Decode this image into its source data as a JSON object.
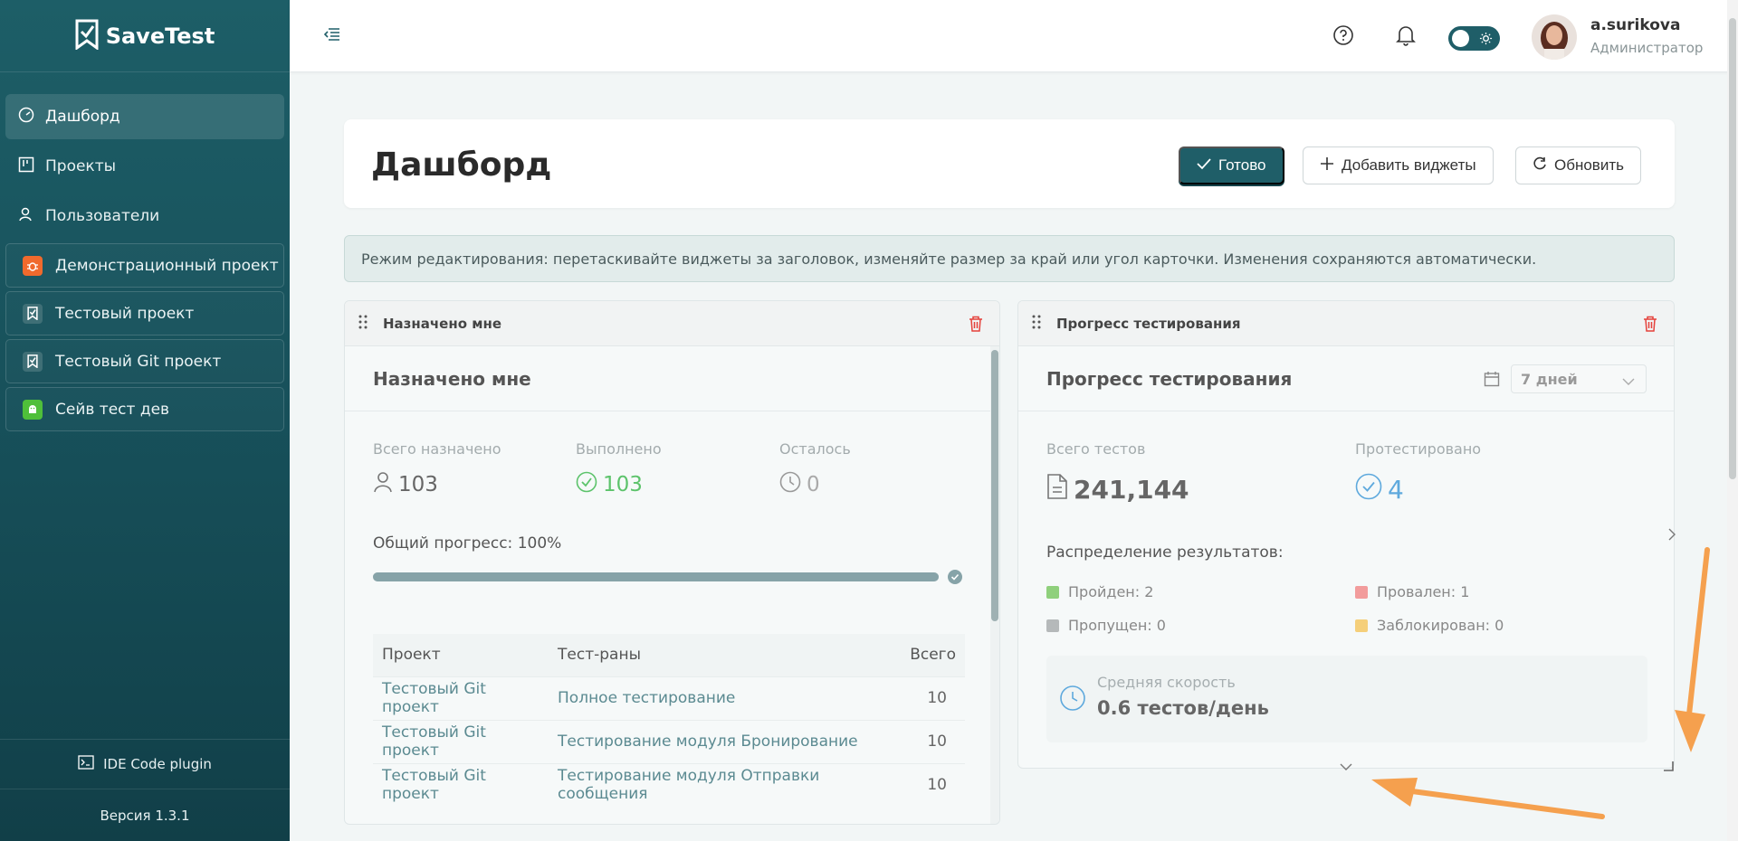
{
  "app": {
    "name": "SaveTest"
  },
  "sidebar": {
    "nav": [
      {
        "label": "Дашборд",
        "icon": "dashboard-icon",
        "active": true
      },
      {
        "label": "Проекты",
        "icon": "board-icon",
        "active": false
      },
      {
        "label": "Пользователи",
        "icon": "users-icon",
        "active": false
      }
    ],
    "projects": [
      {
        "label": "Демонстрационный проект",
        "color": "#f06a2d",
        "icon": "bug-icon"
      },
      {
        "label": "Тестовый проект",
        "color": "#3f6f76",
        "icon": "savetest-icon"
      },
      {
        "label": "Тестовый Git проект",
        "color": "#3f6f76",
        "icon": "savetest-icon"
      },
      {
        "label": "Сейв тест дев",
        "color": "#4fbf3a",
        "icon": "android-icon"
      }
    ],
    "plugin_label": "IDE Code plugin",
    "version_label": "Версия 1.3.1"
  },
  "header": {
    "user_name": "a.surikova",
    "user_role": "Администратор"
  },
  "page": {
    "title": "Дашборд",
    "buttons": {
      "ready": "Готово",
      "add_widgets": "Добавить виджеты",
      "refresh": "Обновить"
    },
    "edit_banner": "Режим редактирования: перетаскивайте виджеты за заголовок, изменяйте размер за край или угол карточки. Изменения сохраняются автоматически."
  },
  "widget_assigned": {
    "header_title": "Назначено мне",
    "title": "Назначено мне",
    "stats": {
      "total_label": "Всего назначено",
      "total_value": "103",
      "done_label": "Выполнено",
      "done_value": "103",
      "left_label": "Осталось",
      "left_value": "0"
    },
    "progress_label": "Общий прогресс: 100%",
    "progress_fraction": 1.0,
    "table": {
      "headers": [
        "Проект",
        "Тест-раны",
        "Всего"
      ],
      "rows": [
        [
          "Тестовый Git проект",
          "Полное тестирование",
          "10"
        ],
        [
          "Тестовый Git проект",
          "Тестирование модуля Бронирование",
          "10"
        ],
        [
          "Тестовый Git проект",
          "Тестирование модуля Отправки сообщения",
          "10"
        ]
      ]
    }
  },
  "widget_progress": {
    "header_title": "Прогресс тестирования",
    "title": "Прогресс тестирования",
    "period": "7 дней",
    "total_label": "Всего тестов",
    "total_value": "241,144",
    "tested_label": "Протестировано",
    "tested_value": "4",
    "distribution_title": "Распределение результатов:",
    "legend": [
      {
        "label": "Пройден: 2",
        "color": "#8fd07c"
      },
      {
        "label": "Провален: 1",
        "color": "#f29c9c"
      },
      {
        "label": "Пропущен: 0",
        "color": "#b5b9ba"
      },
      {
        "label": "Заблокирован: 0",
        "color": "#f5cf7a"
      }
    ],
    "speed_label": "Средняя скорость",
    "speed_value": "0.6 тестов/день"
  },
  "colors": {
    "brand": "#1f5e68",
    "accent_green": "#5cc36b",
    "accent_blue": "#5ea9dd",
    "annotation_orange": "#f5a04e"
  }
}
